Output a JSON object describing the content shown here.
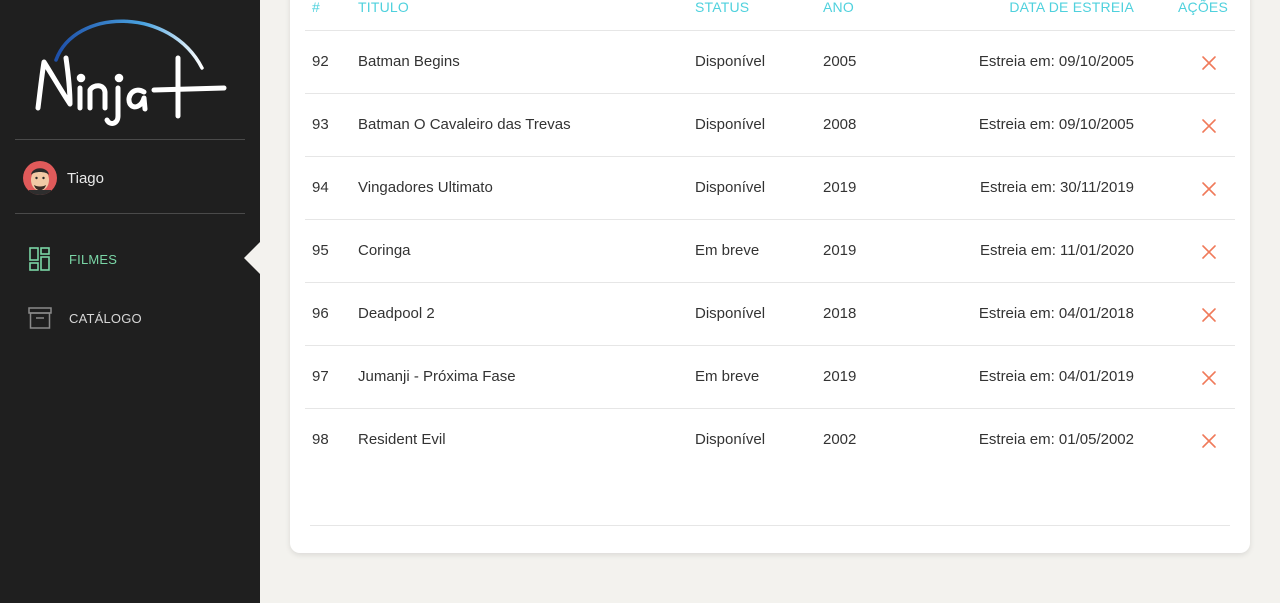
{
  "app": {
    "brand": "Ninja+"
  },
  "user": {
    "name": "Tiago"
  },
  "nav": [
    {
      "label": "FILMES",
      "icon": "dashboard-icon",
      "active": true
    },
    {
      "label": "CATÁLOGO",
      "icon": "archive-icon",
      "active": false
    }
  ],
  "table": {
    "headers": {
      "num": "#",
      "title": "TITULO",
      "status": "STATUS",
      "year": "ANO",
      "date": "DATA DE ESTREIA",
      "actions": "AÇÕES"
    },
    "rows": [
      {
        "num": "92",
        "title": "Batman Begins",
        "status": "Disponível",
        "year": "2005",
        "date": "Estreia em: 09/10/2005"
      },
      {
        "num": "93",
        "title": "Batman O Cavaleiro das Trevas",
        "status": "Disponível",
        "year": "2008",
        "date": "Estreia em: 09/10/2005"
      },
      {
        "num": "94",
        "title": "Vingadores Ultimato",
        "status": "Disponível",
        "year": "2019",
        "date": "Estreia em: 30/11/2019"
      },
      {
        "num": "95",
        "title": "Coringa",
        "status": "Em breve",
        "year": "2019",
        "date": "Estreia em: 11/01/2020"
      },
      {
        "num": "96",
        "title": "Deadpool 2",
        "status": "Disponível",
        "year": "2018",
        "date": "Estreia em: 04/01/2018"
      },
      {
        "num": "97",
        "title": "Jumanji - Próxima Fase",
        "status": "Em breve",
        "year": "2019",
        "date": "Estreia em: 04/01/2019"
      },
      {
        "num": "98",
        "title": "Resident Evil",
        "status": "Disponível",
        "year": "2002",
        "date": "Estreia em: 01/05/2002"
      }
    ]
  },
  "colors": {
    "sidebar": "#1f1f1f",
    "accent_header": "#4fd1dd",
    "nav_active": "#7ad6a6",
    "delete": "#f07a5a"
  }
}
